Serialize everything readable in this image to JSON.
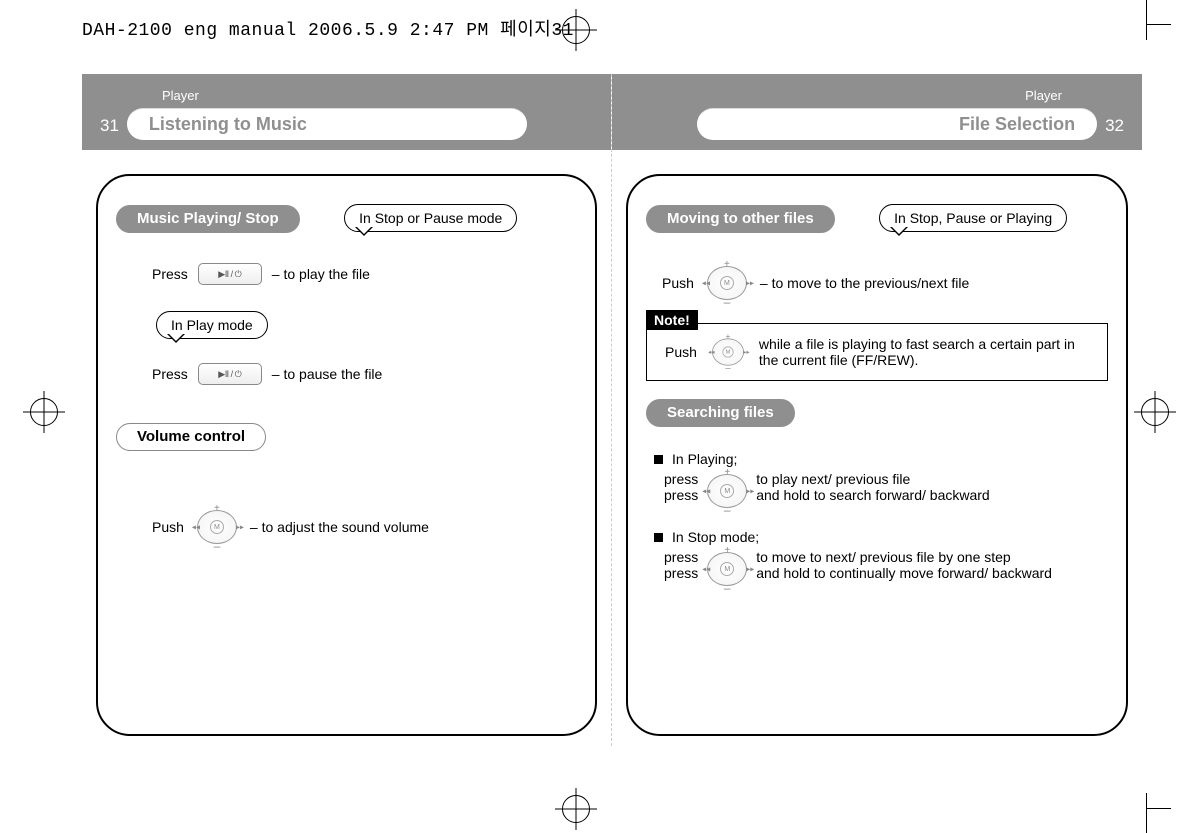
{
  "print_meta": "DAH-2100 eng manual  2006.5.9 2:47 PM 페이지31",
  "left": {
    "page_num": "31",
    "section": "Player",
    "title": "Listening to Music",
    "chip1": "Music Playing/ Stop",
    "bubble1": "In Stop or Pause mode",
    "press": "Press",
    "play_suffix": "– to play the file",
    "bubble2": "In Play mode",
    "pause_suffix": "– to pause the file",
    "chip2": "Volume control",
    "push": "Push",
    "vol_suffix": "– to adjust the sound volume"
  },
  "right": {
    "page_num": "32",
    "section": "Player",
    "title": "File Selection",
    "chip1": "Moving to other files",
    "bubble1": "In Stop, Pause or Playing",
    "push": "Push",
    "move_suffix": "– to move to the previous/next file",
    "note_label": "Note!",
    "note_push": "Push",
    "note_text": "while a file is playing to fast search a certain part in the current file (FF/REW).",
    "chip2": "Searching files",
    "heading_playing": "In Playing;",
    "press": "press",
    "p_line1": "to play next/ previous file",
    "p_line2": "and hold to search forward/ backward",
    "heading_stop": "In Stop mode;",
    "s_line1": "to move to next/ previous file by one step",
    "s_line2": "and hold to continually move forward/ backward"
  }
}
